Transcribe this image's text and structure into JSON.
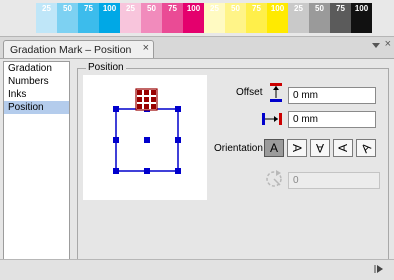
{
  "color_strip": [
    {
      "label": "25",
      "bg": "#bfe6f8",
      "fg": "#ffffff"
    },
    {
      "label": "50",
      "bg": "#7dd1f2",
      "fg": "#ffffff"
    },
    {
      "label": "75",
      "bg": "#3cbcec",
      "fg": "#ffffff"
    },
    {
      "label": "100",
      "bg": "#00a8e6",
      "fg": "#ffffff"
    },
    {
      "label": "25",
      "bg": "#f8c5dc",
      "fg": "#ffffff"
    },
    {
      "label": "50",
      "bg": "#f18bbc",
      "fg": "#ffffff"
    },
    {
      "label": "75",
      "bg": "#ea4b95",
      "fg": "#ffffff"
    },
    {
      "label": "100",
      "bg": "#e4006d",
      "fg": "#ffffff"
    },
    {
      "label": "25",
      "bg": "#fffac2",
      "fg": "#ffffff"
    },
    {
      "label": "50",
      "bg": "#fff488",
      "fg": "#ffffff"
    },
    {
      "label": "75",
      "bg": "#ffef4a",
      "fg": "#ffffff"
    },
    {
      "label": "100",
      "bg": "#ffea00",
      "fg": "#ffffff"
    },
    {
      "label": "25",
      "bg": "#c9c9c9",
      "fg": "#ffffff"
    },
    {
      "label": "50",
      "bg": "#9a9a9a",
      "fg": "#ffffff"
    },
    {
      "label": "75",
      "bg": "#5b5b5b",
      "fg": "#ffffff"
    },
    {
      "label": "100",
      "bg": "#111111",
      "fg": "#ffffff"
    }
  ],
  "panel": {
    "tab_title": "Gradation Mark – Position",
    "tab_close": "×",
    "panel_close": "×"
  },
  "sidebar": {
    "items": [
      {
        "label": "Gradation",
        "selected": false
      },
      {
        "label": "Numbers",
        "selected": false
      },
      {
        "label": "Inks",
        "selected": false
      },
      {
        "label": "Position",
        "selected": true
      }
    ]
  },
  "position": {
    "group_label": "Position",
    "offset_label": "Offset",
    "offset_vertical": "0 mm",
    "offset_horizontal": "0 mm",
    "orientation_label": "Orientation",
    "orientation_buttons": [
      {
        "glyph": "A",
        "selected": true
      },
      {
        "glyph": "A",
        "selected": false
      },
      {
        "glyph": "A",
        "selected": false
      },
      {
        "glyph": "A",
        "selected": false
      },
      {
        "glyph": "A",
        "selected": false
      }
    ],
    "rotation_value": "0"
  },
  "colors": {
    "selection_blue": "#0000cc",
    "mark_red": "#990000",
    "list_selection": "#b4ccec"
  }
}
